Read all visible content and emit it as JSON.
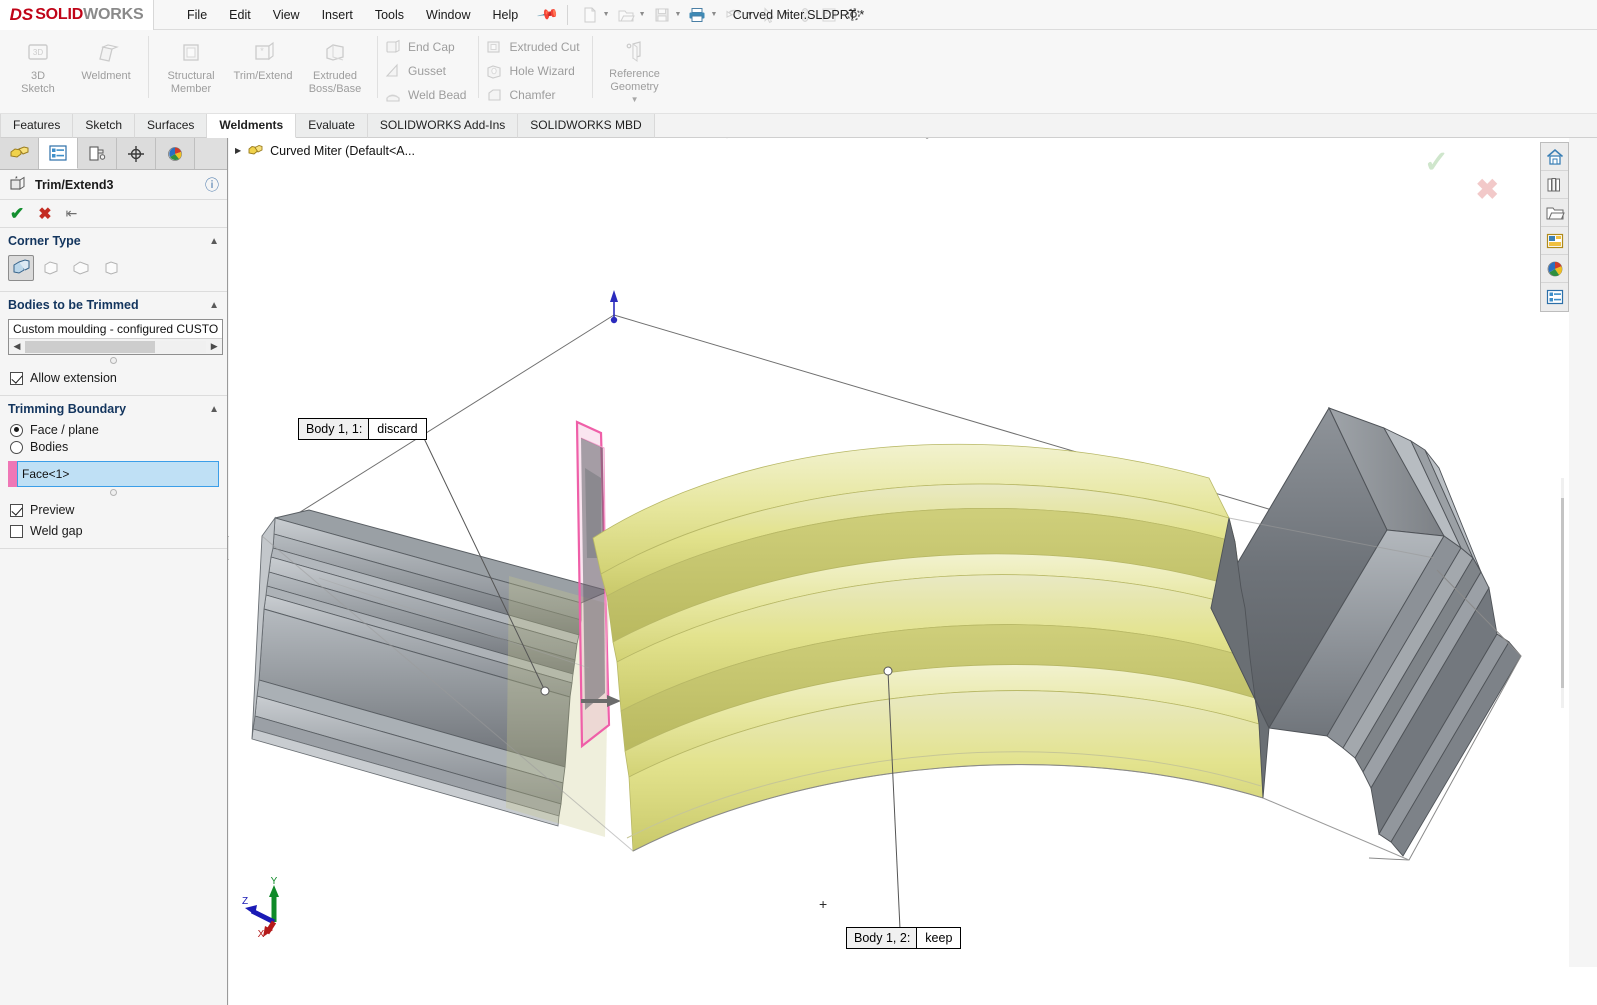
{
  "app": {
    "brand_prefix": "DS",
    "brand_name": "SOLIDWORKS",
    "brand_bold": "SOLID",
    "brand_light": "WORKS",
    "document_title": "Curved Miter.SLDPRT *",
    "accent_red": "#c00418",
    "accent_blue": "#3b9ee8",
    "accent_pink": "#ef77b6",
    "body_yellow": "#dcdc82",
    "body_gray": "#7d8186"
  },
  "menu": {
    "items": [
      "File",
      "Edit",
      "View",
      "Insert",
      "Tools",
      "Window",
      "Help"
    ],
    "pin_icon": "pin-icon",
    "quick_access": [
      {
        "name": "new-document-icon",
        "has_caret": true
      },
      {
        "name": "open-document-icon",
        "has_caret": true
      },
      {
        "name": "save-icon",
        "has_caret": true
      },
      {
        "name": "print-icon",
        "has_caret": true
      },
      {
        "name": "undo-icon",
        "has_caret": true
      },
      {
        "name": "select-arrow-icon",
        "has_caret": true
      },
      {
        "name": "rebuild-icon",
        "has_caret": false
      },
      {
        "name": "options-list-icon",
        "has_caret": false
      },
      {
        "name": "settings-gear-icon",
        "has_caret": false
      }
    ]
  },
  "ribbon": {
    "big_buttons": [
      {
        "label_line1": "3D",
        "label_line2": "Sketch",
        "icon": "3d-sketch-icon"
      },
      {
        "label_line1": "Weldment",
        "label_line2": "",
        "icon": "weldment-icon"
      },
      {
        "label_line1": "Structural",
        "label_line2": "Member",
        "icon": "structural-member-icon"
      },
      {
        "label_line1": "Trim/Extend",
        "label_line2": "",
        "icon": "trim-extend-icon"
      },
      {
        "label_line1": "Extruded",
        "label_line2": "Boss/Base",
        "icon": "extruded-boss-icon"
      }
    ],
    "small_col_1": [
      {
        "label": "End Cap",
        "icon": "end-cap-icon"
      },
      {
        "label": "Gusset",
        "icon": "gusset-icon"
      },
      {
        "label": "Weld Bead",
        "icon": "weld-bead-icon"
      }
    ],
    "small_col_2": [
      {
        "label": "Extruded Cut",
        "icon": "extruded-cut-icon"
      },
      {
        "label": "Hole Wizard",
        "icon": "hole-wizard-icon"
      },
      {
        "label": "Chamfer",
        "icon": "chamfer-icon"
      }
    ],
    "reference_geometry": {
      "label_line1": "Reference",
      "label_line2": "Geometry",
      "icon": "reference-geometry-icon"
    }
  },
  "command_tabs": {
    "items": [
      "Features",
      "Sketch",
      "Surfaces",
      "Weldments",
      "Evaluate",
      "SOLIDWORKS Add-Ins",
      "SOLIDWORKS MBD"
    ],
    "active": "Weldments"
  },
  "left_panel": {
    "tabs": [
      {
        "name": "feature-manager-tab",
        "icon": "feature-tree-icon",
        "active": false
      },
      {
        "name": "property-manager-tab",
        "icon": "property-manager-icon",
        "active": true
      },
      {
        "name": "configuration-manager-tab",
        "icon": "configuration-icon",
        "active": false
      },
      {
        "name": "dimxpert-manager-tab",
        "icon": "dimxpert-icon",
        "active": false
      },
      {
        "name": "display-manager-tab",
        "icon": "display-manager-icon",
        "active": false
      }
    ],
    "feature_title": "Trim/Extend3",
    "feature_icon": "trim-extend-icon",
    "help_icon": "help-icon",
    "actions": {
      "ok": "ok-checkmark",
      "cancel": "cancel-x",
      "pin": "pin-icon"
    },
    "sections": {
      "corner_type": {
        "title": "Corner Type",
        "options": [
          {
            "name": "end-trim-corner",
            "selected": true
          },
          {
            "name": "end-miter-corner",
            "selected": false
          },
          {
            "name": "end-butt1-corner",
            "selected": false
          },
          {
            "name": "end-butt2-corner",
            "selected": false
          }
        ]
      },
      "bodies_to_be_trimmed": {
        "title": "Bodies to be Trimmed",
        "selection": "Custom moulding - configured CUSTO",
        "allow_extension": {
          "label": "Allow extension",
          "checked": true
        }
      },
      "trimming_boundary": {
        "title": "Trimming Boundary",
        "radio_face_plane": {
          "label": "Face / plane",
          "selected": true
        },
        "radio_bodies": {
          "label": "Bodies",
          "selected": false
        },
        "selection": "Face<1>",
        "preview": {
          "label": "Preview",
          "checked": true
        },
        "weld_gap": {
          "label": "Weld gap",
          "checked": false
        }
      }
    }
  },
  "feature_tree": {
    "root_label": "Curved Miter  (Default<A...",
    "root_icon": "part-icon",
    "expand_arrow": "chevron-right-icon"
  },
  "viewport": {
    "hud_tools": [
      {
        "name": "zoom-to-fit-icon",
        "caret": false
      },
      {
        "name": "zoom-to-area-icon",
        "caret": false
      },
      {
        "name": "previous-view-icon",
        "caret": false
      },
      {
        "name": "section-view-icon",
        "caret": false
      },
      {
        "name": "view-orientation-icon",
        "caret": true
      },
      {
        "name": "display-style-icon",
        "caret": false
      },
      {
        "name": "hide-show-items-icon",
        "caret": false
      },
      {
        "name": "edit-appearance-icon",
        "caret": true
      },
      {
        "name": "apply-scene-icon",
        "caret": true
      },
      {
        "name": "view-settings-icon",
        "caret": true
      },
      {
        "name": "display-screen-icon",
        "caret": true
      }
    ],
    "window_buttons": [
      {
        "name": "restore-left-icon"
      },
      {
        "name": "restore-right-icon"
      },
      {
        "name": "minimize-icon"
      },
      {
        "name": "restore-icon"
      },
      {
        "name": "close-icon"
      }
    ],
    "right_toolbar": [
      {
        "name": "home-icon"
      },
      {
        "name": "design-library-icon"
      },
      {
        "name": "file-explorer-icon"
      },
      {
        "name": "view-palette-icon"
      },
      {
        "name": "appearances-icon"
      },
      {
        "name": "custom-properties-icon"
      }
    ],
    "confirm_corner": {
      "ok": "confirm-check-icon",
      "cancel": "confirm-x-icon"
    },
    "triad": {
      "x_label": "X",
      "y_label": "Y",
      "z_label": "Z"
    },
    "callouts": [
      {
        "name": "callout-discard",
        "left": "Body 1,  1:",
        "right": "discard"
      },
      {
        "name": "callout-keep",
        "left": "Body 1,  2:",
        "right": "keep"
      }
    ],
    "origin_marker": "+"
  }
}
